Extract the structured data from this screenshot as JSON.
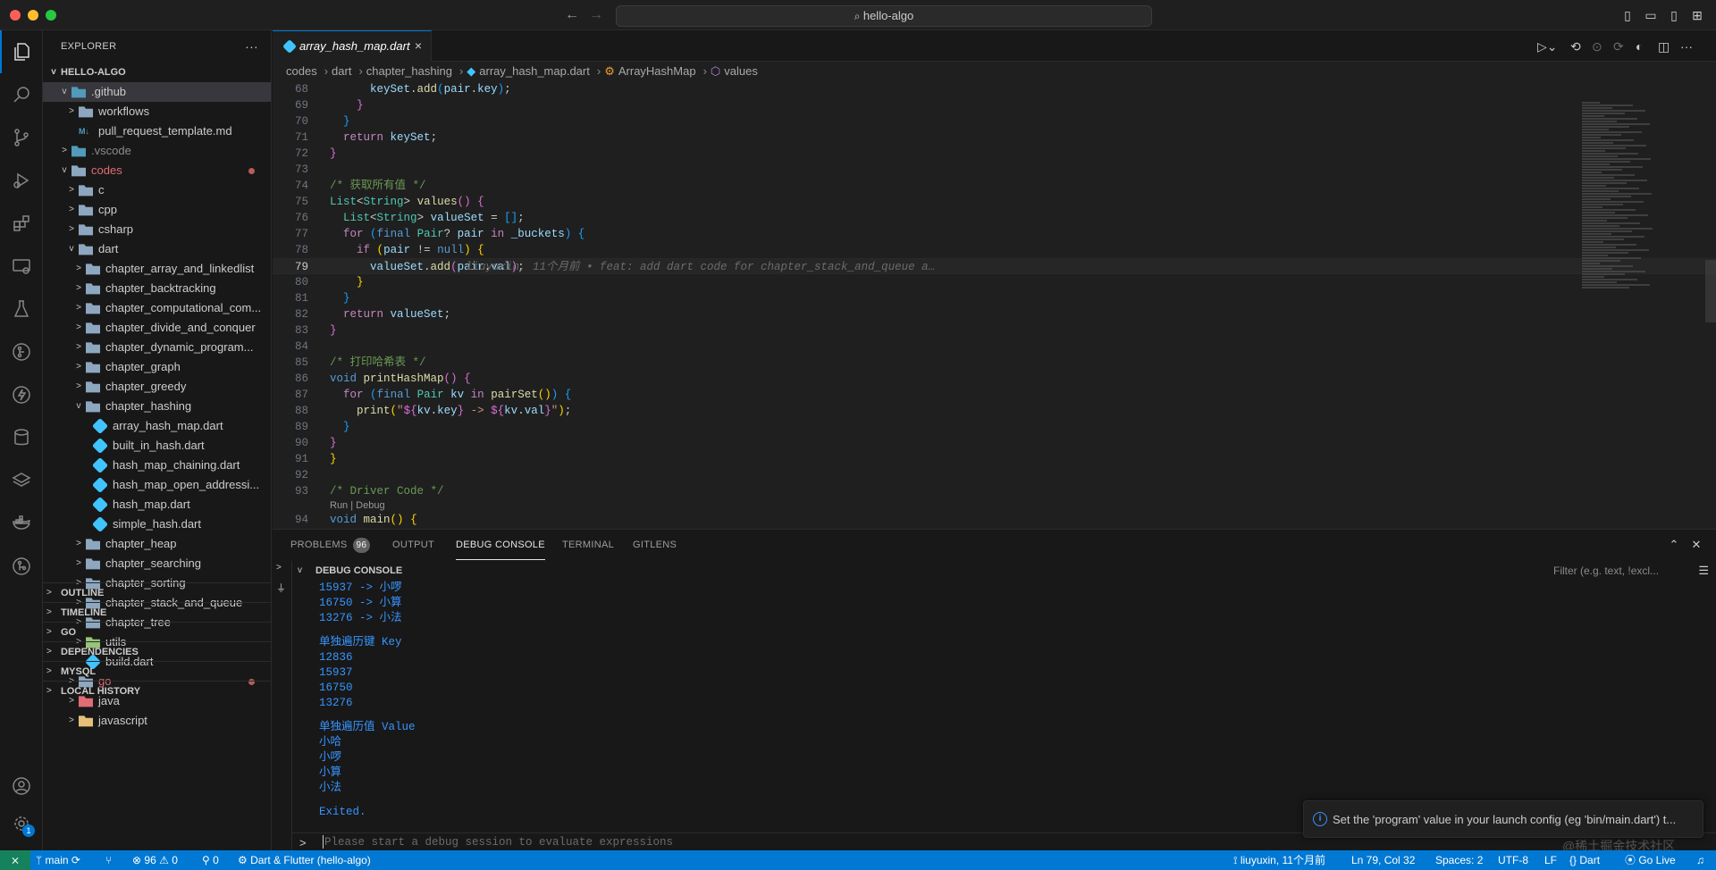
{
  "titlebar": {
    "search_text": "hello-algo",
    "back": "←",
    "forward": "→"
  },
  "activity": {
    "settings_badge": "1"
  },
  "explorer": {
    "title": "EXPLORER",
    "more": "···",
    "root": "HELLO-ALGO",
    "tree": [
      {
        "label": ".github",
        "depth": 1,
        "chev": "v",
        "icon": "folder-blue",
        "selected": true
      },
      {
        "label": "workflows",
        "depth": 2,
        "chev": ">",
        "icon": "folder"
      },
      {
        "label": "pull_request_template.md",
        "depth": 2,
        "chev": "",
        "icon": "md"
      },
      {
        "label": ".vscode",
        "depth": 1,
        "chev": ">",
        "icon": "folder-blue",
        "dim": true
      },
      {
        "label": "codes",
        "depth": 1,
        "chev": "v",
        "icon": "folder",
        "color": "#e06c75",
        "modified": true
      },
      {
        "label": "c",
        "depth": 2,
        "chev": ">",
        "icon": "folder"
      },
      {
        "label": "cpp",
        "depth": 2,
        "chev": ">",
        "icon": "folder"
      },
      {
        "label": "csharp",
        "depth": 2,
        "chev": ">",
        "icon": "folder"
      },
      {
        "label": "dart",
        "depth": 2,
        "chev": "v",
        "icon": "folder"
      },
      {
        "label": "chapter_array_and_linkedlist",
        "depth": 3,
        "chev": ">",
        "icon": "folder"
      },
      {
        "label": "chapter_backtracking",
        "depth": 3,
        "chev": ">",
        "icon": "folder"
      },
      {
        "label": "chapter_computational_com...",
        "depth": 3,
        "chev": ">",
        "icon": "folder"
      },
      {
        "label": "chapter_divide_and_conquer",
        "depth": 3,
        "chev": ">",
        "icon": "folder"
      },
      {
        "label": "chapter_dynamic_program...",
        "depth": 3,
        "chev": ">",
        "icon": "folder"
      },
      {
        "label": "chapter_graph",
        "depth": 3,
        "chev": ">",
        "icon": "folder"
      },
      {
        "label": "chapter_greedy",
        "depth": 3,
        "chev": ">",
        "icon": "folder"
      },
      {
        "label": "chapter_hashing",
        "depth": 3,
        "chev": "v",
        "icon": "folder"
      },
      {
        "label": "array_hash_map.dart",
        "depth": 4,
        "chev": "",
        "icon": "dart"
      },
      {
        "label": "built_in_hash.dart",
        "depth": 4,
        "chev": "",
        "icon": "dart"
      },
      {
        "label": "hash_map_chaining.dart",
        "depth": 4,
        "chev": "",
        "icon": "dart"
      },
      {
        "label": "hash_map_open_addressi...",
        "depth": 4,
        "chev": "",
        "icon": "dart"
      },
      {
        "label": "hash_map.dart",
        "depth": 4,
        "chev": "",
        "icon": "dart"
      },
      {
        "label": "simple_hash.dart",
        "depth": 4,
        "chev": "",
        "icon": "dart"
      },
      {
        "label": "chapter_heap",
        "depth": 3,
        "chev": ">",
        "icon": "folder"
      },
      {
        "label": "chapter_searching",
        "depth": 3,
        "chev": ">",
        "icon": "folder"
      },
      {
        "label": "chapter_sorting",
        "depth": 3,
        "chev": ">",
        "icon": "folder"
      },
      {
        "label": "chapter_stack_and_queue",
        "depth": 3,
        "chev": ">",
        "icon": "folder"
      },
      {
        "label": "chapter_tree",
        "depth": 3,
        "chev": ">",
        "icon": "folder"
      },
      {
        "label": "utils",
        "depth": 3,
        "chev": ">",
        "icon": "folder-green"
      },
      {
        "label": "build.dart",
        "depth": 3,
        "chev": "",
        "icon": "dart"
      },
      {
        "label": "go",
        "depth": 2,
        "chev": ">",
        "icon": "folder",
        "color": "#e06c75",
        "modified": true
      },
      {
        "label": "java",
        "depth": 2,
        "chev": ">",
        "icon": "folder-red"
      },
      {
        "label": "javascript",
        "depth": 2,
        "chev": ">",
        "icon": "folder-yellow"
      }
    ],
    "sections": [
      "OUTLINE",
      "TIMELINE",
      "GO",
      "DEPENDENCIES",
      "MYSQL",
      "LOCAL HISTORY"
    ]
  },
  "editor": {
    "tab_label": "array_hash_map.dart",
    "tab_close": "×",
    "breadcrumb": [
      "codes",
      "dart",
      "chapter_hashing",
      "array_hash_map.dart",
      "ArrayHashMap",
      "values"
    ],
    "codelens": "Run | Debug",
    "blame": "liuyuxin, 11个月前 • feat: add dart code for chapter_stack_and_queue a…",
    "lines": [
      {
        "n": "68",
        "html": "      <span class=\"vr\">keySet</span>.<span class=\"fn\">add</span><span class=\"pn3\">(</span><span class=\"vr\">pair</span>.<span class=\"vr\">key</span><span class=\"pn3\">)</span>;"
      },
      {
        "n": "69",
        "html": "    <span class=\"pn2\">}</span>"
      },
      {
        "n": "70",
        "html": "  <span class=\"pn3\">}</span>"
      },
      {
        "n": "71",
        "html": "  <span class=\"kw2\">return</span> <span class=\"vr\">keySet</span>;"
      },
      {
        "n": "72",
        "html": "<span class=\"pn2\">}</span>"
      },
      {
        "n": "73",
        "html": ""
      },
      {
        "n": "74",
        "html": "<span class=\"cm\">/* 获取所有值 */</span>"
      },
      {
        "n": "75",
        "html": "<span class=\"ty\">List</span>&lt;<span class=\"ty\">String</span>&gt; <span class=\"fn\">values</span><span class=\"pn2\">()</span> <span class=\"pn2\">{</span>"
      },
      {
        "n": "76",
        "html": "  <span class=\"ty\">List</span>&lt;<span class=\"ty\">String</span>&gt; <span class=\"vr\">valueSet</span> = <span class=\"pn3\">[]</span>;"
      },
      {
        "n": "77",
        "html": "  <span class=\"kw2\">for</span> <span class=\"pn3\">(</span><span class=\"kw\">final</span> <span class=\"ty\">Pair</span>? <span class=\"vr\">pair</span> <span class=\"kw2\">in</span> <span class=\"vr\">_buckets</span><span class=\"pn3\">)</span> <span class=\"pn3\">{</span>"
      },
      {
        "n": "78",
        "html": "    <span class=\"kw2\">if</span> <span class=\"pn\">(</span><span class=\"vr\">pair</span> != <span class=\"kw\">null</span><span class=\"pn\">)</span> <span class=\"pn\">{</span>"
      },
      {
        "n": "79",
        "html": "      <span class=\"vr\">valueSet</span>.<span class=\"fn\">add</span><span class=\"pn2\">(</span><span class=\"vr\">pair</span>.<span class=\"vr\">val</span><span class=\"pn2\">)</span>;",
        "current": true
      },
      {
        "n": "80",
        "html": "    <span class=\"pn\">}</span>"
      },
      {
        "n": "81",
        "html": "  <span class=\"pn3\">}</span>"
      },
      {
        "n": "82",
        "html": "  <span class=\"kw2\">return</span> <span class=\"vr\">valueSet</span>;"
      },
      {
        "n": "83",
        "html": "<span class=\"pn2\">}</span>"
      },
      {
        "n": "84",
        "html": ""
      },
      {
        "n": "85",
        "html": "<span class=\"cm\">/* 打印哈希表 */</span>"
      },
      {
        "n": "86",
        "html": "<span class=\"kw\">void</span> <span class=\"fn\">printHashMap</span><span class=\"pn2\">()</span> <span class=\"pn2\">{</span>"
      },
      {
        "n": "87",
        "html": "  <span class=\"kw2\">for</span> <span class=\"pn3\">(</span><span class=\"kw\">final</span> <span class=\"ty\">Pair</span> <span class=\"vr\">kv</span> <span class=\"kw2\">in</span> <span class=\"fn\">pairSet</span><span class=\"pn\">()</span><span class=\"pn3\">)</span> <span class=\"pn3\">{</span>"
      },
      {
        "n": "88",
        "html": "    <span class=\"fn\">print</span><span class=\"pn\">(</span><span class=\"st\">\"</span><span class=\"pn2\">${</span><span class=\"vr\">kv</span>.<span class=\"vr\">key</span><span class=\"pn2\">}</span><span class=\"st\"> -&gt; </span><span class=\"pn2\">${</span><span class=\"vr\">kv</span>.<span class=\"vr\">val</span><span class=\"pn2\">}</span><span class=\"st\">\"</span><span class=\"pn\">)</span>;"
      },
      {
        "n": "89",
        "html": "  <span class=\"pn3\">}</span>"
      },
      {
        "n": "90",
        "html": "<span class=\"pn2\">}</span>"
      },
      {
        "n": "91",
        "html": "<span class=\"pn\">}</span>"
      },
      {
        "n": "92",
        "html": ""
      },
      {
        "n": "93",
        "html": "<span class=\"cm\">/* Driver Code */</span>"
      },
      {
        "n": "94",
        "html": "<span class=\"kw\">void</span> <span class=\"fn\">main</span><span class=\"pn\">()</span> <span class=\"pn\">{</span>",
        "lens_before": true
      }
    ]
  },
  "panel": {
    "tabs": [
      "PROBLEMS",
      "OUTPUT",
      "DEBUG CONSOLE",
      "TERMINAL",
      "GITLENS"
    ],
    "problems_count": "96",
    "section_title": "DEBUG CONSOLE",
    "filter_placeholder": "Filter (e.g. text, !excl...",
    "console_lines": [
      "15937 -> 小啰",
      "16750 -> 小算",
      "13276 -> 小法",
      "",
      "单独遍历键 Key",
      "12836",
      "15937",
      "16750",
      "13276",
      "",
      "单独遍历值 Value",
      "小哈",
      "小啰",
      "小算",
      "小法",
      "",
      "Exited."
    ],
    "input_placeholder": "Please start a debug session to evaluate expressions"
  },
  "notification": {
    "text": "Set the 'program' value in your launch config (eg 'bin/main.dart') t..."
  },
  "statusbar": {
    "remote": "⨯",
    "branch": "main",
    "problems": "96",
    "warnings": "0",
    "ports": "0",
    "launch": "Dart & Flutter (hello-algo)",
    "blame": "liuyuxin, 11个月前",
    "position": "Ln 79, Col 32",
    "spaces": "Spaces: 2",
    "encoding": "UTF-8",
    "eol": "LF",
    "language": "Dart",
    "golive": "Go Live"
  },
  "watermark": "@稀土掘金技术社区"
}
